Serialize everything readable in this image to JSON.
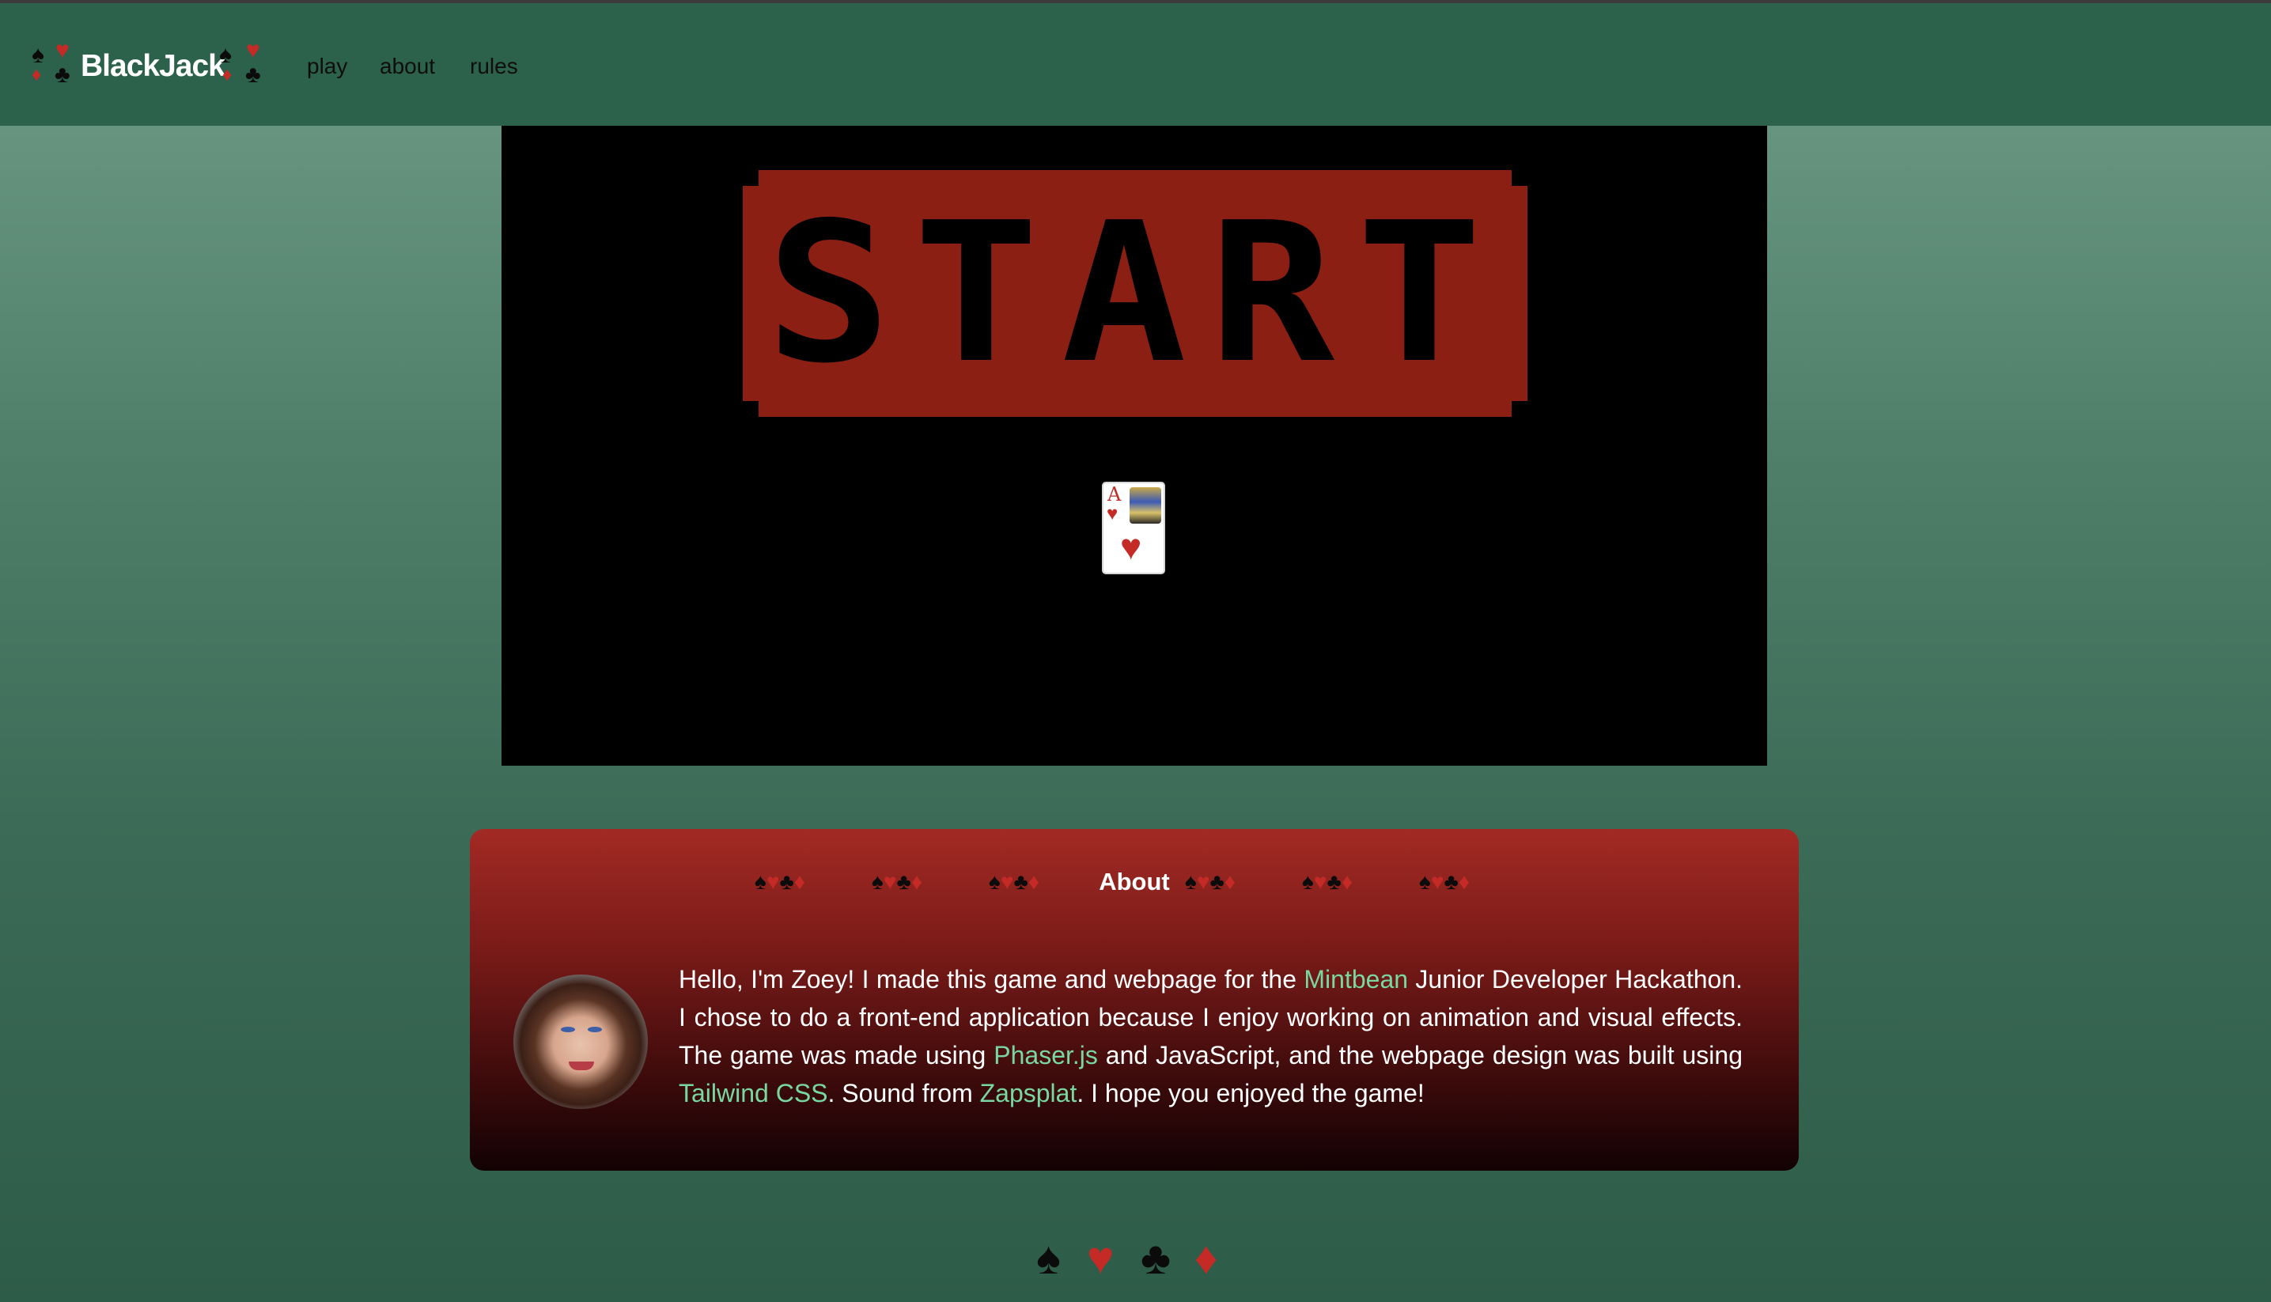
{
  "nav": {
    "logo_text": "BlackJack",
    "links": [
      "play",
      "about",
      "rules"
    ]
  },
  "game": {
    "start_label": "START",
    "card": {
      "rank": "A",
      "suit_icon": "heart-icon"
    }
  },
  "about": {
    "title": "About",
    "intro_1": "Hello, I'm Zoey! I made this game and webpage for the ",
    "link_mintbean": "Mintbean",
    "intro_2": " Junior Developer Hackathon. I chose to do a front-end application because I enjoy working on animation and visual effects. The game was made using ",
    "link_phaser": "Phaser.js",
    "intro_3": " and JavaScript, and the webpage design was built using ",
    "link_tailwind": "Tailwind CSS",
    "intro_4": ". Sound from ",
    "link_zapsplat": "Zapsplat",
    "intro_5": ". I hope you enjoyed the game!"
  },
  "colors": {
    "nav_bg": "#2c614c",
    "start_bg": "#8c1f14",
    "link": "#79d7a1",
    "suit_red": "#c42a26",
    "panel_top": "#a32a24"
  },
  "icons": {
    "spade": "♠",
    "heart": "♥",
    "club": "♣",
    "diamond": "♦"
  }
}
